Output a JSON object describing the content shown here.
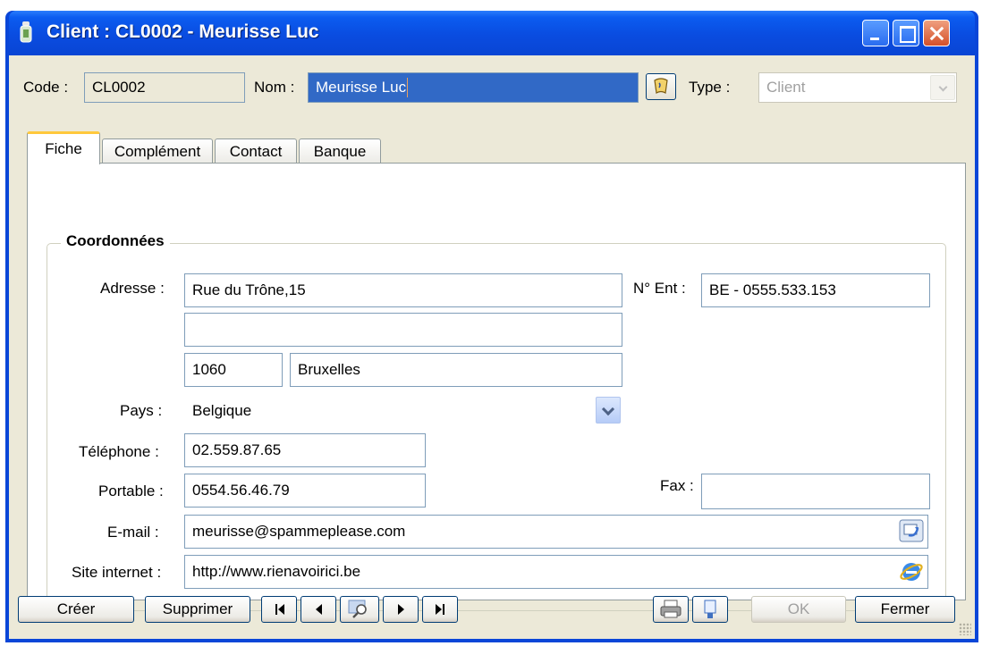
{
  "window": {
    "title": "Client : CL0002 - Meurisse Luc"
  },
  "header": {
    "code_label": "Code :",
    "code_value": "CL0002",
    "nom_label": "Nom :",
    "nom_value": "Meurisse Luc",
    "type_label": "Type :",
    "type_value": "Client"
  },
  "tabs": [
    {
      "label": "Fiche",
      "active": true
    },
    {
      "label": "Complément",
      "active": false
    },
    {
      "label": "Contact",
      "active": false
    },
    {
      "label": "Banque",
      "active": false
    }
  ],
  "coordonnees": {
    "title": "Coordonnées",
    "adresse_label": "Adresse :",
    "adresse_line1": "Rue du Trône,15",
    "adresse_line2": "",
    "code_postal": "1060",
    "ville": "Bruxelles",
    "pays_label": "Pays :",
    "pays_value": "Belgique",
    "telephone_label": "Téléphone :",
    "telephone_value": "02.559.87.65",
    "portable_label": "Portable :",
    "portable_value": "0554.56.46.79",
    "email_label": "E-mail :",
    "email_value": "meurisse@spammeplease.com",
    "site_label": "Site internet :",
    "site_value": "http://www.rienavoirici.be",
    "nent_label": "N° Ent :",
    "nent_value": "BE - 0555.533.153",
    "fax_label": "Fax :",
    "fax_value": ""
  },
  "buttons": {
    "creer": "Créer",
    "supprimer": "Supprimer",
    "ok": "OK",
    "fermer": "Fermer"
  },
  "icons": {
    "title": "client-icon",
    "name_action": "phone-book-icon",
    "email_action": "send-mail-icon",
    "site_action": "internet-explorer-icon",
    "print": "printer-icon",
    "label_print": "label-print-icon",
    "search": "magnifier-icon"
  }
}
